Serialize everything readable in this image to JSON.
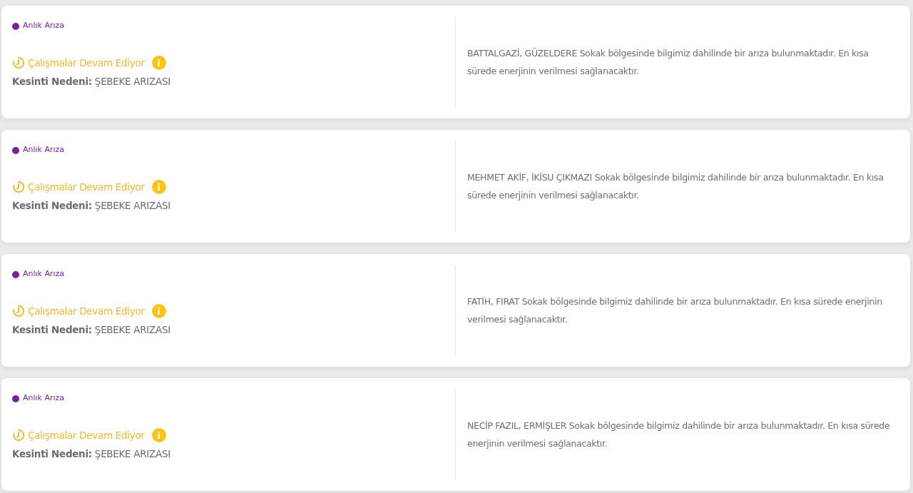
{
  "outages": [
    {
      "tag": {
        "label": "Anlık Arıza",
        "color": "#7b1fa2"
      },
      "status": "Çalışmalar Devam Ediyor",
      "info": "i",
      "reason_label": "Kesinti Nedeni:",
      "reason": "ŞEBEKE ARIZASI",
      "description": "BATTALGAZİ, GÜZELDERE Sokak bölgesinde bilgimiz dahilinde bir arıza bulunmaktadır. En kısa sürede enerjinin verilmesi sağlanacaktır."
    },
    {
      "tag": {
        "label": "Anlık Arıza",
        "color": "#7b1fa2"
      },
      "status": "Çalışmalar Devam Ediyor",
      "info": "i",
      "reason_label": "Kesinti Nedeni:",
      "reason": "ŞEBEKE ARIZASI",
      "description": "MEHMET AKİF, İKİSU ÇIKMAZI Sokak bölgesinde bilgimiz dahilinde bir arıza bulunmaktadır. En kısa sürede enerjinin verilmesi sağlanacaktır."
    },
    {
      "tag": {
        "label": "Anlık Arıza",
        "color": "#7b1fa2"
      },
      "status": "Çalışmalar Devam Ediyor",
      "info": "i",
      "reason_label": "Kesinti Nedeni:",
      "reason": "ŞEBEKE ARIZASI",
      "description": "FATİH, FIRAT Sokak bölgesinde bilgimiz dahilinde bir arıza bulunmaktadır. En kısa sürede enerjinin verilmesi sağlanacaktır."
    },
    {
      "tag": {
        "label": "Anlık Arıza",
        "color": "#7b1fa2"
      },
      "status": "Çalışmalar Devam Ediyor",
      "info": "i",
      "reason_label": "Kesinti Nedeni:",
      "reason": "ŞEBEKE ARIZASI",
      "description": "NECİP FAZIL, ERMİŞLER Sokak bölgesinde bilgimiz dahilinde bir arıza bulunmaktadır. En kısa sürede enerjinin verilmesi sağlanacaktır."
    }
  ]
}
